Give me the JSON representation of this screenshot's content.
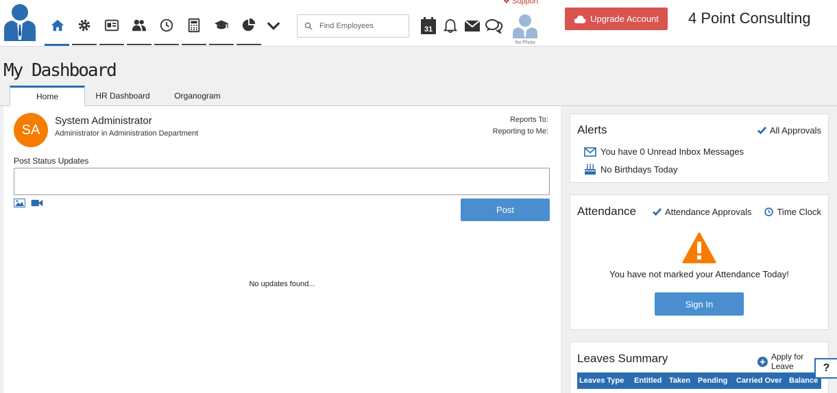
{
  "header": {
    "support_label": "Support",
    "search_placeholder": "Find Employees",
    "calendar_day": "31",
    "avatar_caption": "No Photo",
    "upgrade_label": "Upgrade Account",
    "company_name": "4 Point Consulting"
  },
  "page": {
    "title": "My Dashboard",
    "tabs": [
      {
        "label": "Home",
        "active": true
      },
      {
        "label": "HR Dashboard",
        "active": false
      },
      {
        "label": "Organogram",
        "active": false
      }
    ]
  },
  "profile": {
    "initials": "SA",
    "name": "System Administrator",
    "role": "Administrator in Administration Department",
    "reports_to_label": "Reports To:",
    "reporting_to_me_label": "Reporting to Me:"
  },
  "status": {
    "label": "Post Status Updates",
    "post_label": "Post",
    "empty_message": "No updates found..."
  },
  "alerts": {
    "title": "Alerts",
    "all_approvals_label": "All Approvals",
    "inbox_message": "You have 0 Unread Inbox Messages",
    "birthday_message": "No Birthdays Today"
  },
  "attendance": {
    "title": "Attendance",
    "approvals_label": "Attendance Approvals",
    "time_clock_label": "Time Clock",
    "message": "You have not marked your Attendance Today!",
    "sign_in_label": "Sign In"
  },
  "leaves": {
    "title": "Leaves Summary",
    "apply_label": "Apply for Leave",
    "columns": [
      "Leaves Type",
      "Entitled",
      "Taken",
      "Pending",
      "Carried Over",
      "Balance"
    ]
  },
  "help_label": "?",
  "colors": {
    "accent": "#2b6cb0",
    "button": "#4a8ed0",
    "upgrade": "#d9534f",
    "avatar": "#f57c00",
    "warning": "#f57c00"
  }
}
